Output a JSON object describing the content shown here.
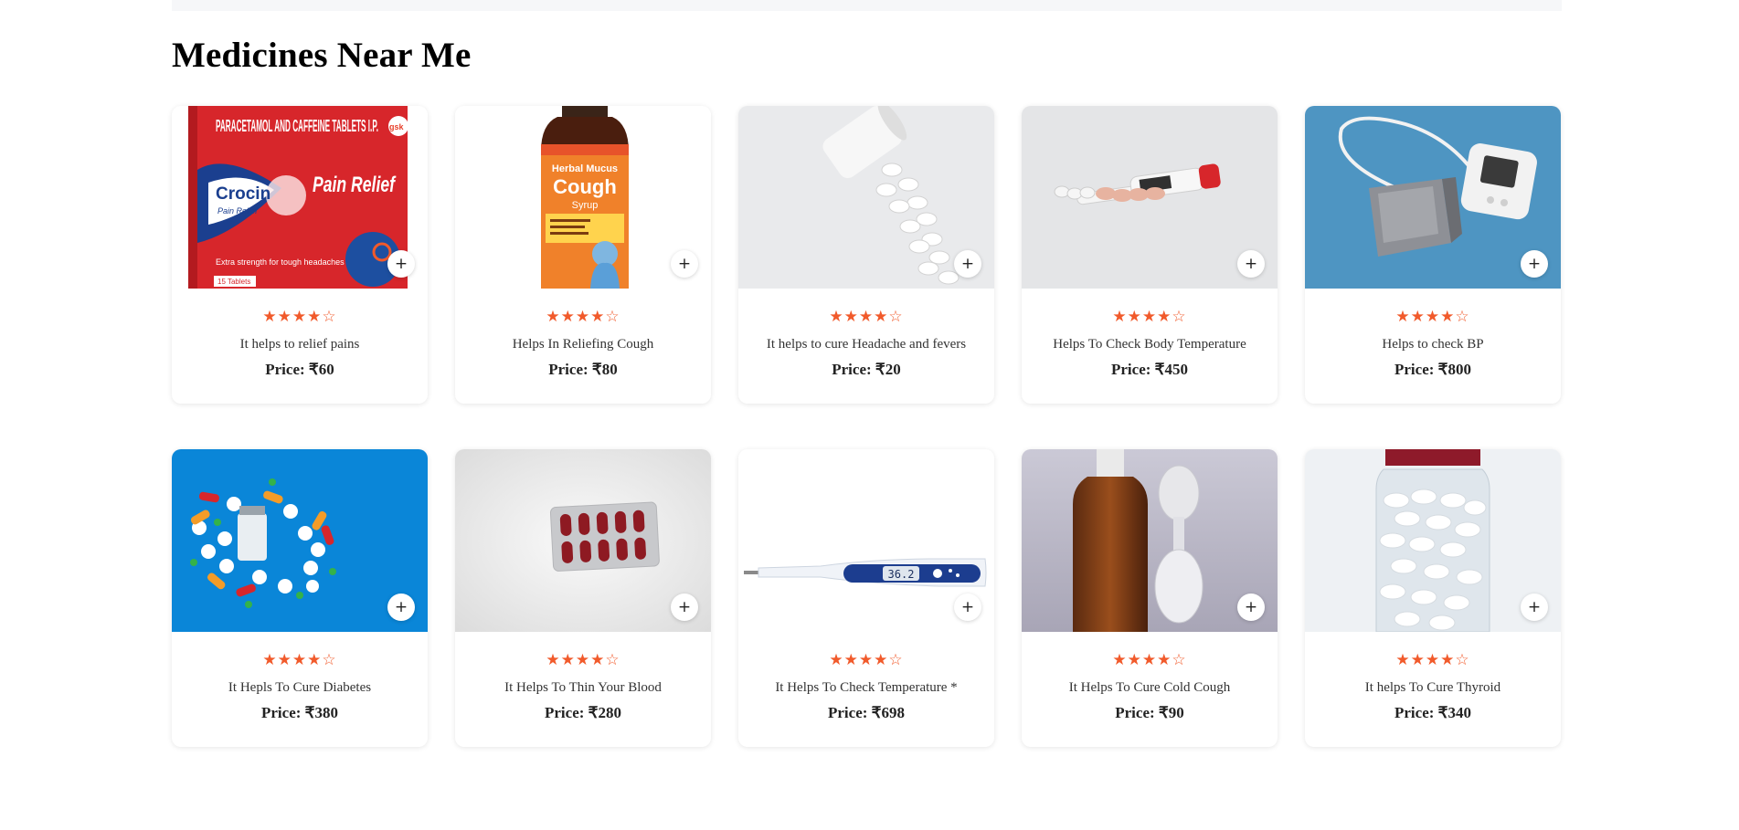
{
  "page_title": "Medicines Near Me",
  "add_label": "+",
  "colors": {
    "star": "#f15a2b",
    "accent_red": "#d7262b"
  },
  "products": [
    {
      "image_name": "crocin-box-image",
      "art": {
        "pack_title": "PARACETAMOL AND CAFFEINE TABLETS I.P.",
        "brand": "Crocin",
        "brand_sub": "Pain Relief",
        "headline": "Pain Relief",
        "strength": "Extra strength for tough headaches",
        "count": "15 Tablets",
        "maker": "gsk"
      },
      "rating": 4,
      "description": "It helps to relief pains",
      "price": "Price: ₹60"
    },
    {
      "image_name": "cough-syrup-image",
      "art": {
        "line1": "Herbal Mucus",
        "line2": "Cough",
        "line3": "Syrup"
      },
      "rating": 4,
      "description": "Helps In Reliefing Cough",
      "price": "Price: ₹80"
    },
    {
      "image_name": "spilled-pills-image",
      "rating": 4,
      "description": "It helps to cure Headache and fevers",
      "price": "Price: ₹20"
    },
    {
      "image_name": "thermometer-pills-image",
      "rating": 4,
      "description": "Helps To Check Body Temperature",
      "price": "Price: ₹450"
    },
    {
      "image_name": "bp-monitor-image",
      "rating": 4,
      "description": "Helps to check BP",
      "price": "Price: ₹800"
    },
    {
      "image_name": "capsules-vial-image",
      "rating": 4,
      "description": "It Hepls To Cure Diabetes",
      "price": "Price: ₹380"
    },
    {
      "image_name": "blister-pack-image",
      "rating": 4,
      "description": "It Helps To Thin Your Blood",
      "price": "Price: ₹280"
    },
    {
      "image_name": "digital-thermometer-image",
      "art": {
        "reading": "36.2"
      },
      "rating": 4,
      "description": "It Helps To Check Temperature *",
      "price": "Price: ₹698"
    },
    {
      "image_name": "syrup-bottle-spoon-image",
      "rating": 4,
      "description": "It Helps To Cure Cold Cough",
      "price": "Price: ₹90"
    },
    {
      "image_name": "pill-jar-image",
      "rating": 4,
      "description": "It helps To Cure Thyroid",
      "price": "Price: ₹340"
    }
  ]
}
